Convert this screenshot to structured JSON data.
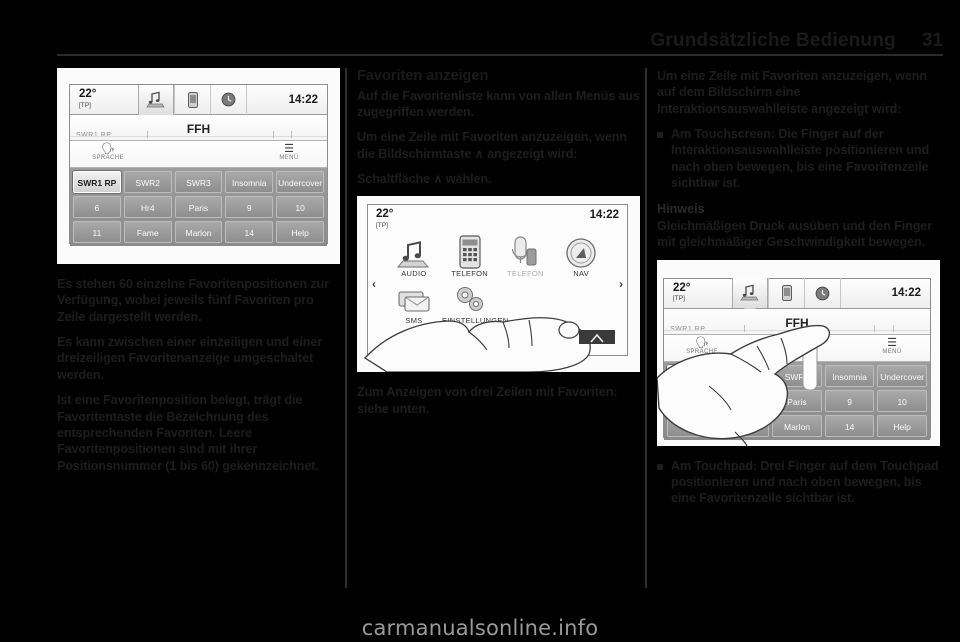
{
  "header": {
    "title": "Grundsätzliche Bedienung",
    "page_number": "31"
  },
  "left_column": {
    "paragraphs": [
      "Es stehen 60 einzelne Favoritenpositionen zur Verfügung, wobei jeweils fünf Favoriten pro Zeile dargestellt werden.",
      "Es kann zwischen einer einzeiligen und einer dreizeiligen Favoritenanzeige umgeschaltet werden.",
      "Ist eine Favoritenposition belegt, trägt die Favoritentaste die Bezeichnung des entsprechenden Favoriten. Leere Favoritenpositionen sind mit ihrer Positionsnummer (1 bis 60) gekennzeichnet."
    ]
  },
  "middle_column": {
    "heading": "Favoriten anzeigen",
    "paragraphs": [
      "Auf die Favoritenliste kann von allen Menüs aus zugegriffen werden.",
      "Um eine Zeile mit Favoriten anzuzeigen, wenn die Bildschirmtaste ∧ angezeigt wird:",
      "Schaltfläche ∧ wählen."
    ],
    "caption_below": "Zum Anzeigen von drei Zeilen mit Favoriten: siehe unten."
  },
  "right_column": {
    "intro": "Um eine Zeile mit Favoriten anzuzeigen, wenn auf dem Bildschirm eine Interaktionsauswahlleiste angezeigt wird:",
    "bullet_1": "Am Touchscreen: Die Finger auf der Interaktionsauswahlleiste positionieren und nach oben bewegen, bis eine Favoritenzeile sichtbar ist.",
    "note_label": "Hinweis",
    "note_text": "Gleichmäßigen Druck ausüben und den Finger mit gleichmäßiger Geschwindigkeit bewegen.",
    "bullet_2": "Am Touchpad: Drei Finger auf dem Touchpad positionieren und nach oben bewegen, bis eine Favoritenzeile sichtbar ist."
  },
  "figure_radio": {
    "status": {
      "temperature": "22°",
      "tp_label": "[TP]",
      "time": "14:22",
      "icons": [
        "audio-note-icon",
        "phone-icon",
        "clock-icon"
      ]
    },
    "station_name": "FFH",
    "blurred_left_label": "SWR1 RP",
    "softkeys": [
      {
        "glyph": "voice-icon",
        "label": "SPRACHE"
      },
      {
        "glyph": "menu-icon",
        "label": "MENÜ"
      }
    ],
    "favorites": [
      [
        "SWR1 RP",
        "SWR2",
        "SWR3",
        "Insomnia",
        "Undercover"
      ],
      [
        "6",
        "Hr4",
        "Paris",
        "9",
        "10"
      ],
      [
        "11",
        "Fame",
        "Marlon",
        "14",
        "Help"
      ]
    ],
    "selected_favorite": "SWR1 RP"
  },
  "figure_home": {
    "status": {
      "temperature": "22°",
      "tp_label": "[TP]",
      "time": "14:22"
    },
    "icons_row1": [
      {
        "name": "audio-icon",
        "label": "AUDIO",
        "dimmed": false
      },
      {
        "name": "phone-icon",
        "label": "TELEFON",
        "dimmed": false
      },
      {
        "name": "phone-portal-icon",
        "label": "TELEFON",
        "dimmed": true
      },
      {
        "name": "nav-compass-icon",
        "label": "NAV",
        "dimmed": false
      }
    ],
    "icons_row2": [
      {
        "name": "sms-icon",
        "label": "SMS",
        "dimmed": false
      },
      {
        "name": "settings-gear-icon",
        "label": "EINSTELLUNGEN",
        "dimmed": false
      }
    ],
    "arrow_left": "‹",
    "arrow_right": "›"
  },
  "watermark": "carmanualsonline.info",
  "colors": {
    "page_background": "#000000",
    "text": "#1d1d1d",
    "rule": "#2b2b2b",
    "screen_frame": "#8d8d8d",
    "favorite_button": "#9a9a9a",
    "watermark": "#9a9a9a"
  }
}
